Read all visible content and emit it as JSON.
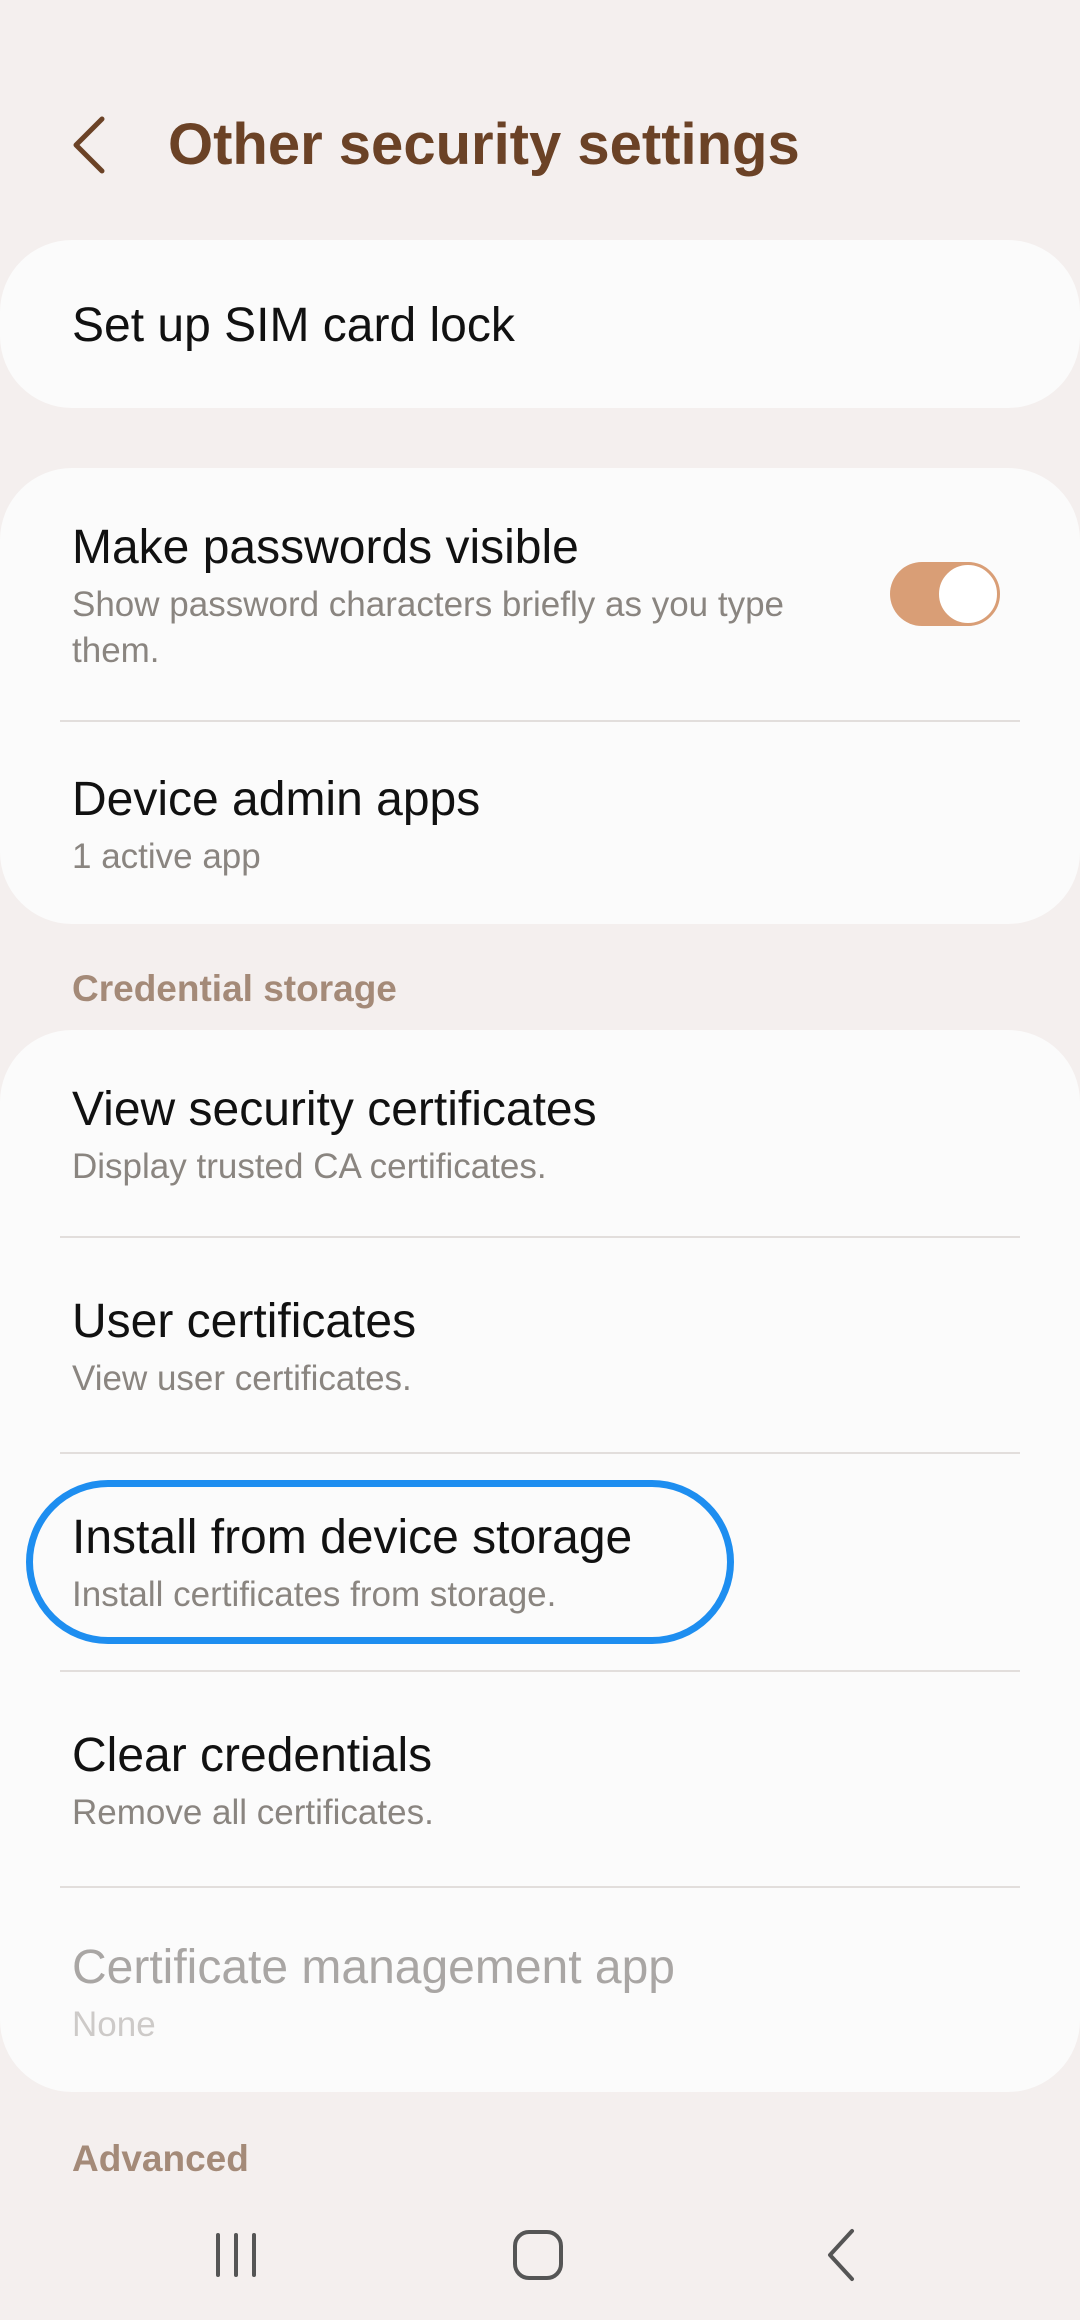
{
  "header": {
    "title": "Other security settings",
    "back_icon": "chevron-left-icon"
  },
  "sim_lock": {
    "title": "Set up SIM card lock"
  },
  "passwords": {
    "title": "Make passwords visible",
    "subtitle": "Show password characters briefly as you type them.",
    "toggle_on": true
  },
  "device_admin": {
    "title": "Device admin apps",
    "subtitle": "1 active app"
  },
  "credential_storage": {
    "header": "Credential storage",
    "items": [
      {
        "title": "View security certificates",
        "subtitle": "Display trusted CA certificates."
      },
      {
        "title": "User certificates",
        "subtitle": "View user certificates."
      },
      {
        "title": "Install from device storage",
        "subtitle": "Install certificates from storage."
      },
      {
        "title": "Clear credentials",
        "subtitle": "Remove all certificates."
      },
      {
        "title": "Certificate management app",
        "subtitle": "None"
      }
    ]
  },
  "advanced": {
    "header": "Advanced"
  },
  "colors": {
    "accent": "#d99e76",
    "title": "#6b4226",
    "highlight": "#1e8ef0",
    "background": "#f4efee"
  },
  "navbar": {
    "recents_icon": "recents-icon",
    "home_icon": "home-icon",
    "back_icon": "back-icon"
  }
}
